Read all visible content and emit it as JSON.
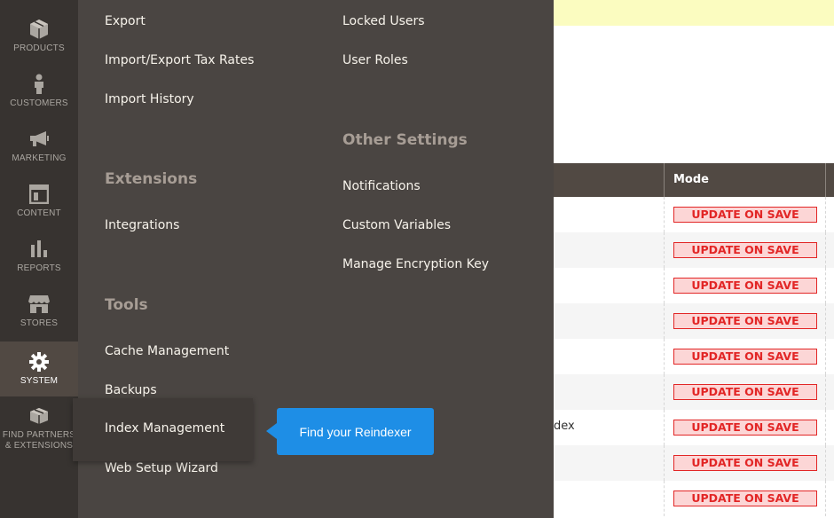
{
  "leftnav": {
    "items": [
      {
        "label": "Products",
        "icon": "cube-icon"
      },
      {
        "label": "Customers",
        "icon": "person-icon"
      },
      {
        "label": "Marketing",
        "icon": "megaphone-icon"
      },
      {
        "label": "Content",
        "icon": "layout-icon"
      },
      {
        "label": "Reports",
        "icon": "bar-chart-icon"
      },
      {
        "label": "Stores",
        "icon": "storefront-icon"
      },
      {
        "label": "System",
        "icon": "gear-icon"
      },
      {
        "label": "Find Partners & Extensions",
        "icon": "boxes-icon"
      }
    ],
    "active": "System"
  },
  "flyout": {
    "col1": {
      "data_transfer_items": [
        "Export",
        "Import/Export Tax Rates",
        "Import History"
      ],
      "extensions_heading": "Extensions",
      "extensions_items": [
        "Integrations"
      ],
      "tools_heading": "Tools",
      "tools_items": [
        "Cache Management",
        "Backups",
        "Index Management",
        "Web Setup Wizard"
      ]
    },
    "col2": {
      "permissions_items": [
        "Locked Users",
        "User Roles"
      ],
      "other_heading": "Other Settings",
      "other_items": [
        "Notifications",
        "Custom Variables",
        "Manage Encryption Key"
      ]
    }
  },
  "tooltip": {
    "text": "Find your Reindexer"
  },
  "grid": {
    "mode_header": "Mode",
    "rows": [
      {
        "text": "",
        "mode": "UPDATE ON SAVE"
      },
      {
        "text": "",
        "mode": "UPDATE ON SAVE"
      },
      {
        "text": "",
        "mode": "UPDATE ON SAVE"
      },
      {
        "text": "",
        "mode": "UPDATE ON SAVE"
      },
      {
        "text": "",
        "mode": "UPDATE ON SAVE"
      },
      {
        "text": "",
        "mode": "UPDATE ON SAVE"
      },
      {
        "text": "dex",
        "mode": "UPDATE ON SAVE"
      },
      {
        "text": "",
        "mode": "UPDATE ON SAVE"
      },
      {
        "text": "",
        "mode": "UPDATE ON SAVE"
      }
    ]
  },
  "colors": {
    "nav_bg": "#373330",
    "flyout_bg": "#4a4542",
    "tooltip_bg": "#1e8ee6",
    "badge_red": "#e22626",
    "notice_yellow": "#fbfcc0"
  }
}
